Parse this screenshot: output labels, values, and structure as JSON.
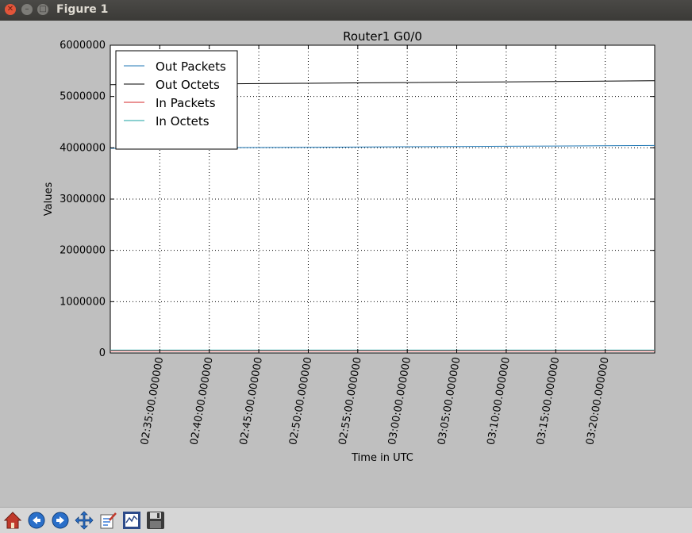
{
  "window": {
    "title": "Figure 1"
  },
  "toolbar": {
    "buttons": [
      {
        "name": "home-icon"
      },
      {
        "name": "back-icon"
      },
      {
        "name": "forward-icon"
      },
      {
        "name": "pan-icon"
      },
      {
        "name": "zoom-icon"
      },
      {
        "name": "configure-subplots-icon"
      },
      {
        "name": "save-icon"
      }
    ]
  },
  "chart_data": {
    "type": "line",
    "title": "Router1 G0/0",
    "xlabel": "Time in UTC",
    "ylabel": "Values",
    "ylim": [
      0,
      6000000
    ],
    "xlim": [
      "02:30:00",
      "03:25:00"
    ],
    "yticks": [
      "0",
      "1000000",
      "2000000",
      "3000000",
      "4000000",
      "5000000",
      "6000000"
    ],
    "xticks": [
      {
        "value": "02:35:00",
        "label": "02:35:00.000000"
      },
      {
        "value": "02:40:00",
        "label": "02:40:00.000000"
      },
      {
        "value": "02:45:00",
        "label": "02:45:00.000000"
      },
      {
        "value": "02:50:00",
        "label": "02:50:00.000000"
      },
      {
        "value": "02:55:00",
        "label": "02:55:00.000000"
      },
      {
        "value": "03:00:00",
        "label": "03:00:00.000000"
      },
      {
        "value": "03:05:00",
        "label": "03:05:00.000000"
      },
      {
        "value": "03:10:00",
        "label": "03:10:00.000000"
      },
      {
        "value": "03:15:00",
        "label": "03:15:00.000000"
      },
      {
        "value": "03:20:00",
        "label": "03:20:00.000000"
      }
    ],
    "grid": true,
    "legend": "top-left",
    "x": [
      "02:30:00",
      "02:35:00",
      "02:40:00",
      "02:45:00",
      "02:50:00",
      "02:55:00",
      "03:00:00",
      "03:05:00",
      "03:10:00",
      "03:15:00",
      "03:20:00",
      "03:25:00"
    ],
    "series": [
      {
        "name": "Out Packets",
        "color": "#1f77b4",
        "values": [
          3990000,
          3995000,
          4000000,
          4005000,
          4010000,
          4015000,
          4020000,
          4025000,
          4030000,
          4035000,
          4040000,
          4045000
        ]
      },
      {
        "name": "Out Octets",
        "color": "#000000",
        "values": [
          5230000,
          5237000,
          5244000,
          5251000,
          5258000,
          5265000,
          5272000,
          5279000,
          5286000,
          5293000,
          5300000,
          5307000
        ]
      },
      {
        "name": "In Packets",
        "color": "#d62728",
        "values": [
          40000,
          40000,
          40000,
          40000,
          40000,
          40000,
          40000,
          40000,
          40000,
          40000,
          40000,
          40000
        ]
      },
      {
        "name": "In Octets",
        "color": "#17a2a2",
        "values": [
          55000,
          55000,
          55000,
          55000,
          55000,
          55000,
          55000,
          55000,
          55000,
          55000,
          55000,
          55000
        ]
      }
    ]
  }
}
